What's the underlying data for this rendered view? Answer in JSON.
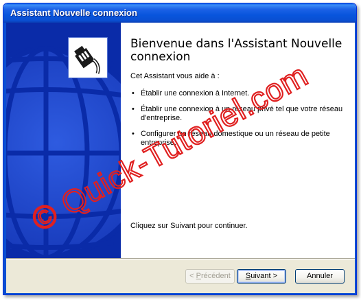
{
  "window": {
    "title": "Assistant Nouvelle connexion"
  },
  "content": {
    "heading": "Bienvenue dans l'Assistant Nouvelle connexion",
    "intro": "Cet Assistant vous aide à :",
    "bullets": [
      "Établir une connexion à Internet.",
      "Établir une connexion à un réseau privé tel que votre réseau d'entreprise.",
      "Configurer un réseau domestique ou un réseau de petite entreprise."
    ],
    "continue_text": "Cliquez sur Suivant pour continuer."
  },
  "buttons": {
    "back": {
      "underline": "P",
      "rest": "récédent",
      "prefix": "< "
    },
    "next": {
      "underline": "S",
      "rest": "uivant >"
    },
    "cancel": "Annuler"
  },
  "watermark": "© Quick-Tutoriel.com",
  "colors": {
    "titlebar": "#0A4FD2",
    "sidebar": "#0A2BA8",
    "watermark": "#E02020"
  },
  "icons": {
    "sidebar_art": "globe-icon",
    "connection": "network-cable-icon"
  }
}
